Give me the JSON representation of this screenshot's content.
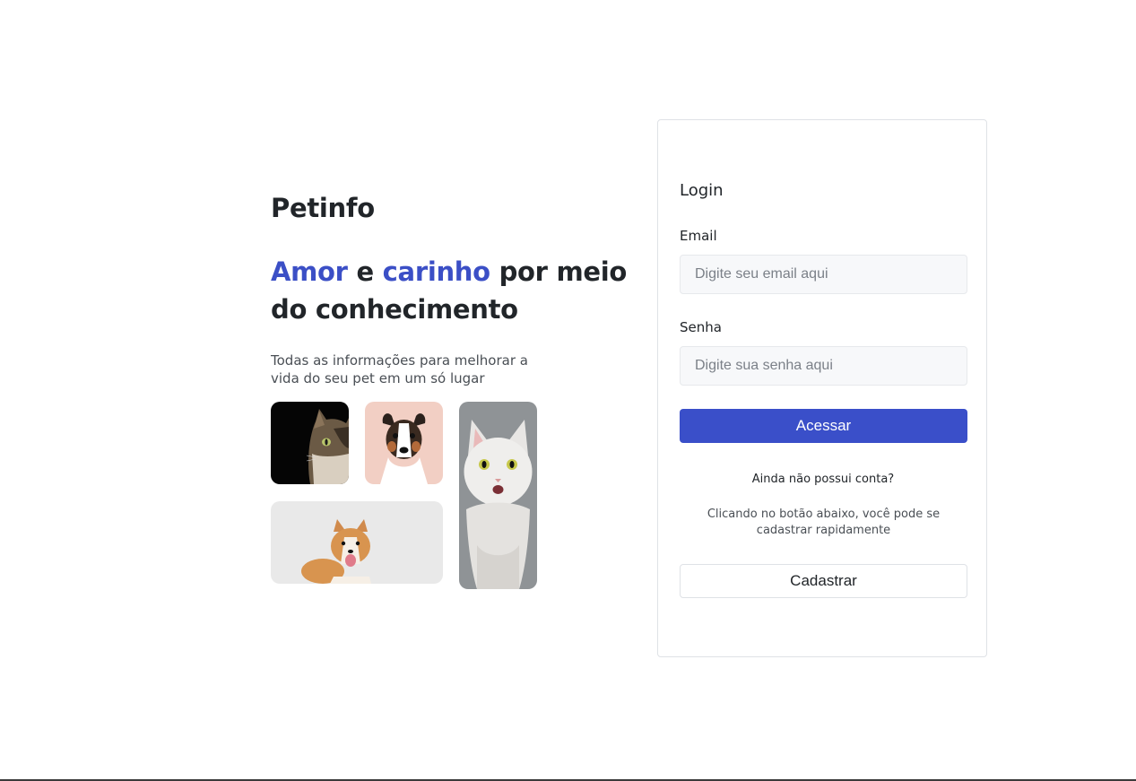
{
  "brand": {
    "name": "Petinfo"
  },
  "hero": {
    "headline": {
      "part1": "Amor",
      "part2": " e ",
      "part3": "carinho",
      "part4": " por meio do conhecimento"
    },
    "subtitle": "Todas as informações para melhorar a vida do seu pet em um só lugar"
  },
  "gallery": {
    "images": [
      {
        "name": "cat-dark-photo"
      },
      {
        "name": "dog-pink-photo"
      },
      {
        "name": "white-cat-photo"
      },
      {
        "name": "corgi-photo"
      }
    ]
  },
  "login": {
    "title": "Login",
    "email_label": "Email",
    "email_placeholder": "Digite seu email aqui",
    "email_value": "",
    "password_label": "Senha",
    "password_placeholder": "Digite sua senha aqui",
    "password_value": "",
    "submit_label": "Acessar",
    "no_account_text": "Ainda não possui conta?",
    "signup_hint": "Clicando no botão abaixo, você pode se cadastrar rapidamente",
    "signup_label": "Cadastrar"
  },
  "colors": {
    "accent": "#3b4fc6",
    "primary_button": "#3a4fc9",
    "text": "#212529",
    "input_bg": "#f7f8fa"
  }
}
